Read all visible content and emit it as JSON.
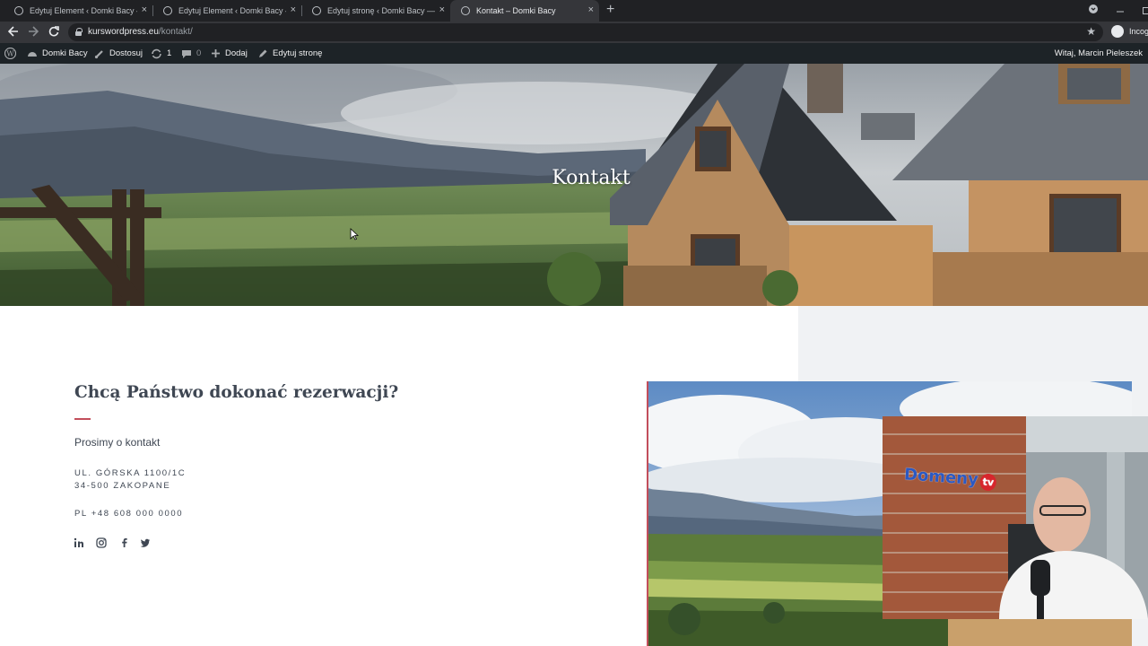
{
  "browser": {
    "tabs": [
      {
        "title": "Edytuj Element ‹ Domki Bacy — WordPress",
        "active": false
      },
      {
        "title": "Edytuj Element ‹ Domki Bacy — WordPress",
        "active": false
      },
      {
        "title": "Edytuj stronę ‹ Domki Bacy — WordPress",
        "active": false
      },
      {
        "title": "Kontakt – Domki Bacy",
        "active": true
      }
    ],
    "close_glyph": "×",
    "new_tab_glyph": "+",
    "url_domain": "kurswordpress.eu",
    "url_path": "/kontakt/",
    "incognito_label": "Incognito",
    "icons": [
      "back-arrow-icon",
      "forward-arrow-icon",
      "reload-icon",
      "lock-icon",
      "star-icon",
      "incognito-icon"
    ]
  },
  "adminbar": {
    "site_name": "Domki Bacy",
    "customize": "Dostosuj",
    "updates_count": "1",
    "comments_count": "0",
    "add_new": "Dodaj",
    "edit_page": "Edytuj stronę",
    "greeting": "Witaj, Marcin Pieleszek"
  },
  "hero": {
    "title": "Kontakt"
  },
  "contact": {
    "heading": "Chcą Państwo dokonać rezerwacji?",
    "subtitle": "Prosimy o kontakt",
    "address_line1": "UL. GÓRSKA 1100/1C",
    "address_line2": "34-500 ZAKOPANE",
    "phone": "PL +48 608 000 0000",
    "social": [
      "linkedin-icon",
      "instagram-icon",
      "facebook-icon",
      "twitter-icon"
    ]
  },
  "overlay": {
    "logo_text": "Domeny",
    "logo_badge": "tv"
  },
  "colors": {
    "accent": "#c24e5b",
    "text": "#3f4753",
    "adminbar": "#1d2327",
    "panel": "#f0f2f4"
  }
}
